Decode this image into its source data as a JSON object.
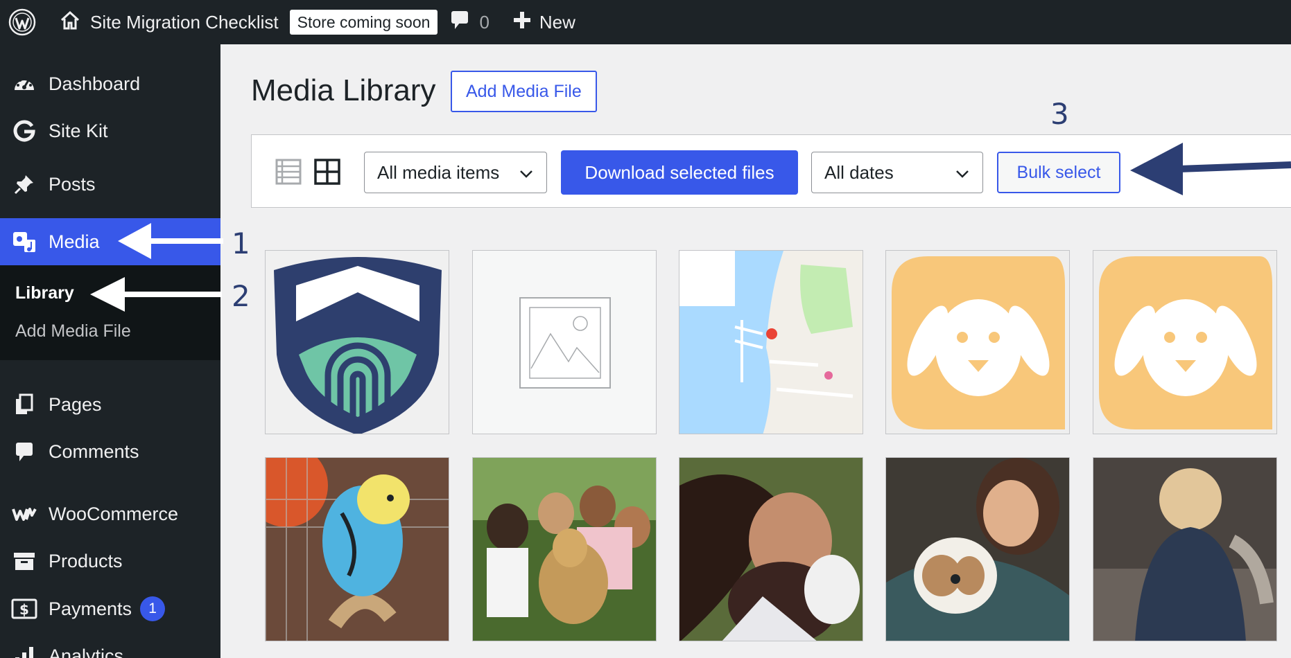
{
  "adminbar": {
    "site_title": "Site Migration Checklist",
    "store_badge": "Store coming soon",
    "comment_count": "0",
    "new_label": "New"
  },
  "sidebar": {
    "items": [
      {
        "label": "Dashboard",
        "icon": "dashboard-icon"
      },
      {
        "label": "Site Kit",
        "icon": "google-g-icon"
      },
      {
        "label": "Posts",
        "icon": "pin-icon"
      },
      {
        "label": "Media",
        "icon": "media-icon",
        "current": true
      },
      {
        "label": "Pages",
        "icon": "pages-icon"
      },
      {
        "label": "Comments",
        "icon": "comment-icon"
      },
      {
        "label": "WooCommerce",
        "icon": "woo-icon"
      },
      {
        "label": "Products",
        "icon": "archive-icon"
      },
      {
        "label": "Payments",
        "icon": "dollar-icon",
        "badge": "1"
      },
      {
        "label": "Analytics",
        "icon": "bar-chart-icon"
      }
    ],
    "submenu": [
      {
        "label": "Library",
        "active": true
      },
      {
        "label": "Add Media File"
      }
    ]
  },
  "main": {
    "title": "Media Library",
    "add_button": "Add Media File",
    "toolbar": {
      "type_filter": "All media items",
      "download_button": "Download selected files",
      "date_filter": "All dates",
      "bulk_button": "Bulk select"
    }
  },
  "annotations": [
    "1",
    "2",
    "3"
  ],
  "media_tiles": [
    {
      "kind": "shield-logo"
    },
    {
      "kind": "image-placeholder"
    },
    {
      "kind": "map"
    },
    {
      "kind": "dog-logo"
    },
    {
      "kind": "dog-logo"
    },
    {
      "kind": "photo-parakeet"
    },
    {
      "kind": "photo-group-dog"
    },
    {
      "kind": "photo-woman-dog"
    },
    {
      "kind": "photo-woman-shihtzu"
    },
    {
      "kind": "photo-child"
    }
  ],
  "colors": {
    "admin_dark": "#1d2327",
    "accent": "#3858e9",
    "submenu_bg": "#101517",
    "annotation": "#2c3e73"
  }
}
